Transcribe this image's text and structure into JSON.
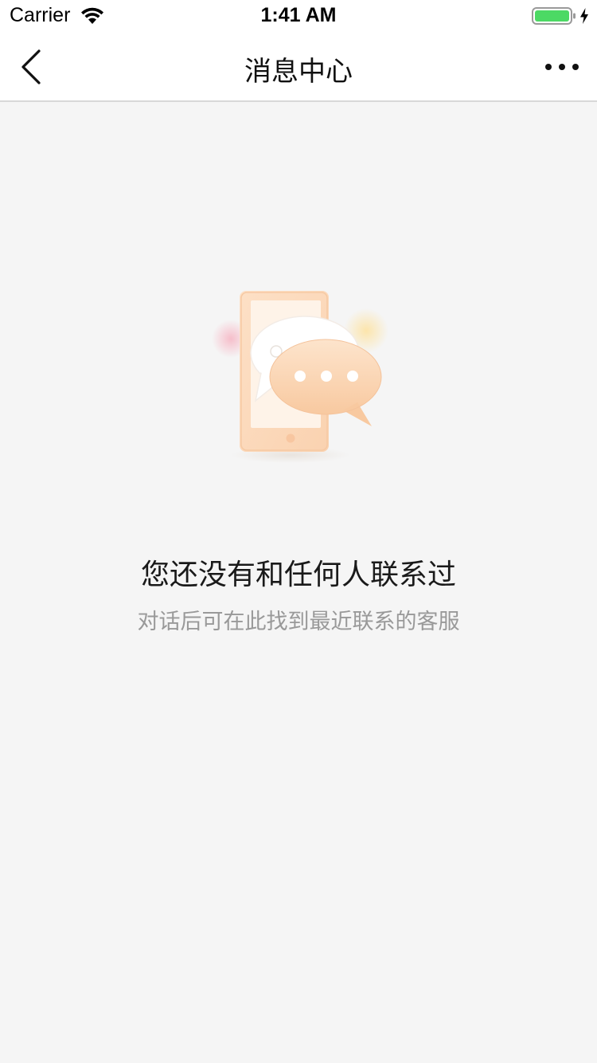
{
  "status_bar": {
    "carrier": "Carrier",
    "time": "1:41 AM",
    "icons": [
      "wifi-icon",
      "battery-icon",
      "charging-icon"
    ],
    "battery_color": "#4cd964"
  },
  "nav": {
    "title": "消息中心",
    "back_icon": "chevron-left-icon",
    "more_icon": "more-horizontal-icon"
  },
  "empty_state": {
    "illustration_icon": "chat-bubbles-phone-icon",
    "title": "您还没有和任何人联系过",
    "subtitle": "对话后可在此找到最近联系的客服",
    "accent_color": "#f7c9a0"
  }
}
